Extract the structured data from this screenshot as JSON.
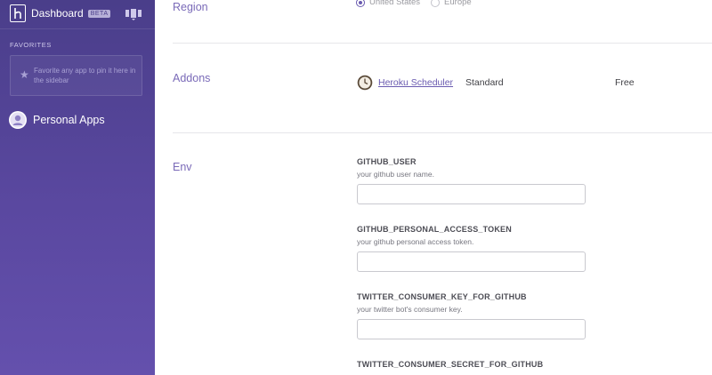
{
  "sidebar": {
    "brand": "Dashboard",
    "badge": "BETA",
    "favorites_heading": "FAVORITES",
    "favorites_hint": "Favorite any app to pin it here in the sidebar",
    "personal_apps": "Personal Apps",
    "icons": {
      "logo": "heroku-logo-icon",
      "apps": "apps-grid-icon",
      "star": "star-icon",
      "avatar": "user-avatar-icon"
    }
  },
  "region": {
    "label": "Region",
    "options": [
      {
        "label": "United States",
        "checked": true
      },
      {
        "label": "Europe",
        "checked": false
      }
    ]
  },
  "addons": {
    "label": "Addons",
    "items": [
      {
        "name": "Heroku Scheduler",
        "plan": "Standard",
        "price": "Free",
        "icon": "clock-icon"
      }
    ]
  },
  "env": {
    "label": "Env",
    "fields": [
      {
        "key": "GITHUB_USER",
        "description": "your github user name.",
        "value": ""
      },
      {
        "key": "GITHUB_PERSONAL_ACCESS_TOKEN",
        "description": "your github personal access token.",
        "value": ""
      },
      {
        "key": "TWITTER_CONSUMER_KEY_FOR_GITHUB",
        "description": "your twitter bot's consumer key.",
        "value": ""
      },
      {
        "key": "TWITTER_CONSUMER_SECRET_FOR_GITHUB",
        "description": "",
        "value": ""
      }
    ]
  },
  "colors": {
    "sidebar_top": "#4a3e8a",
    "sidebar_bottom": "#6450ad",
    "accent": "#6a5bb0",
    "label": "#7a6ab8"
  }
}
